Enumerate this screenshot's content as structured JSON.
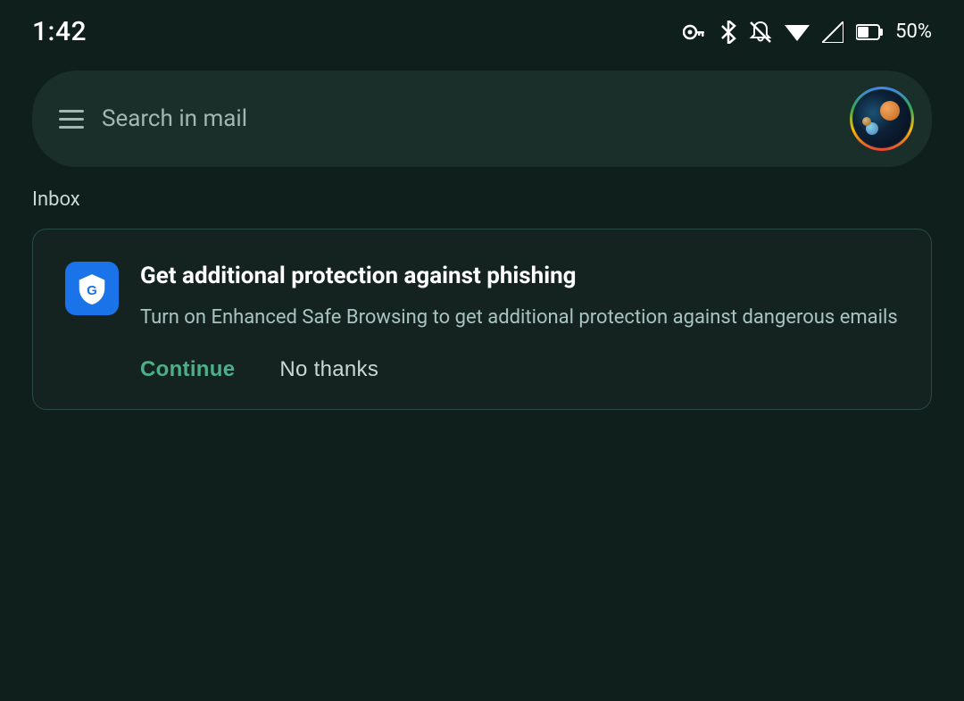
{
  "status_bar": {
    "time": "1:42",
    "battery_percent": "50%",
    "icons": {
      "key": "🔑",
      "bluetooth": "✱",
      "bell_muted": "🔕",
      "wifi": "▼",
      "signal": "◁",
      "battery": "🔋"
    }
  },
  "search_bar": {
    "placeholder": "Search in mail"
  },
  "inbox": {
    "label": "Inbox"
  },
  "promo_card": {
    "title": "Get additional protection against phishing",
    "description": "Turn on Enhanced Safe Browsing to get additional protection against dangerous emails",
    "button_continue": "Continue",
    "button_no_thanks": "No thanks"
  }
}
